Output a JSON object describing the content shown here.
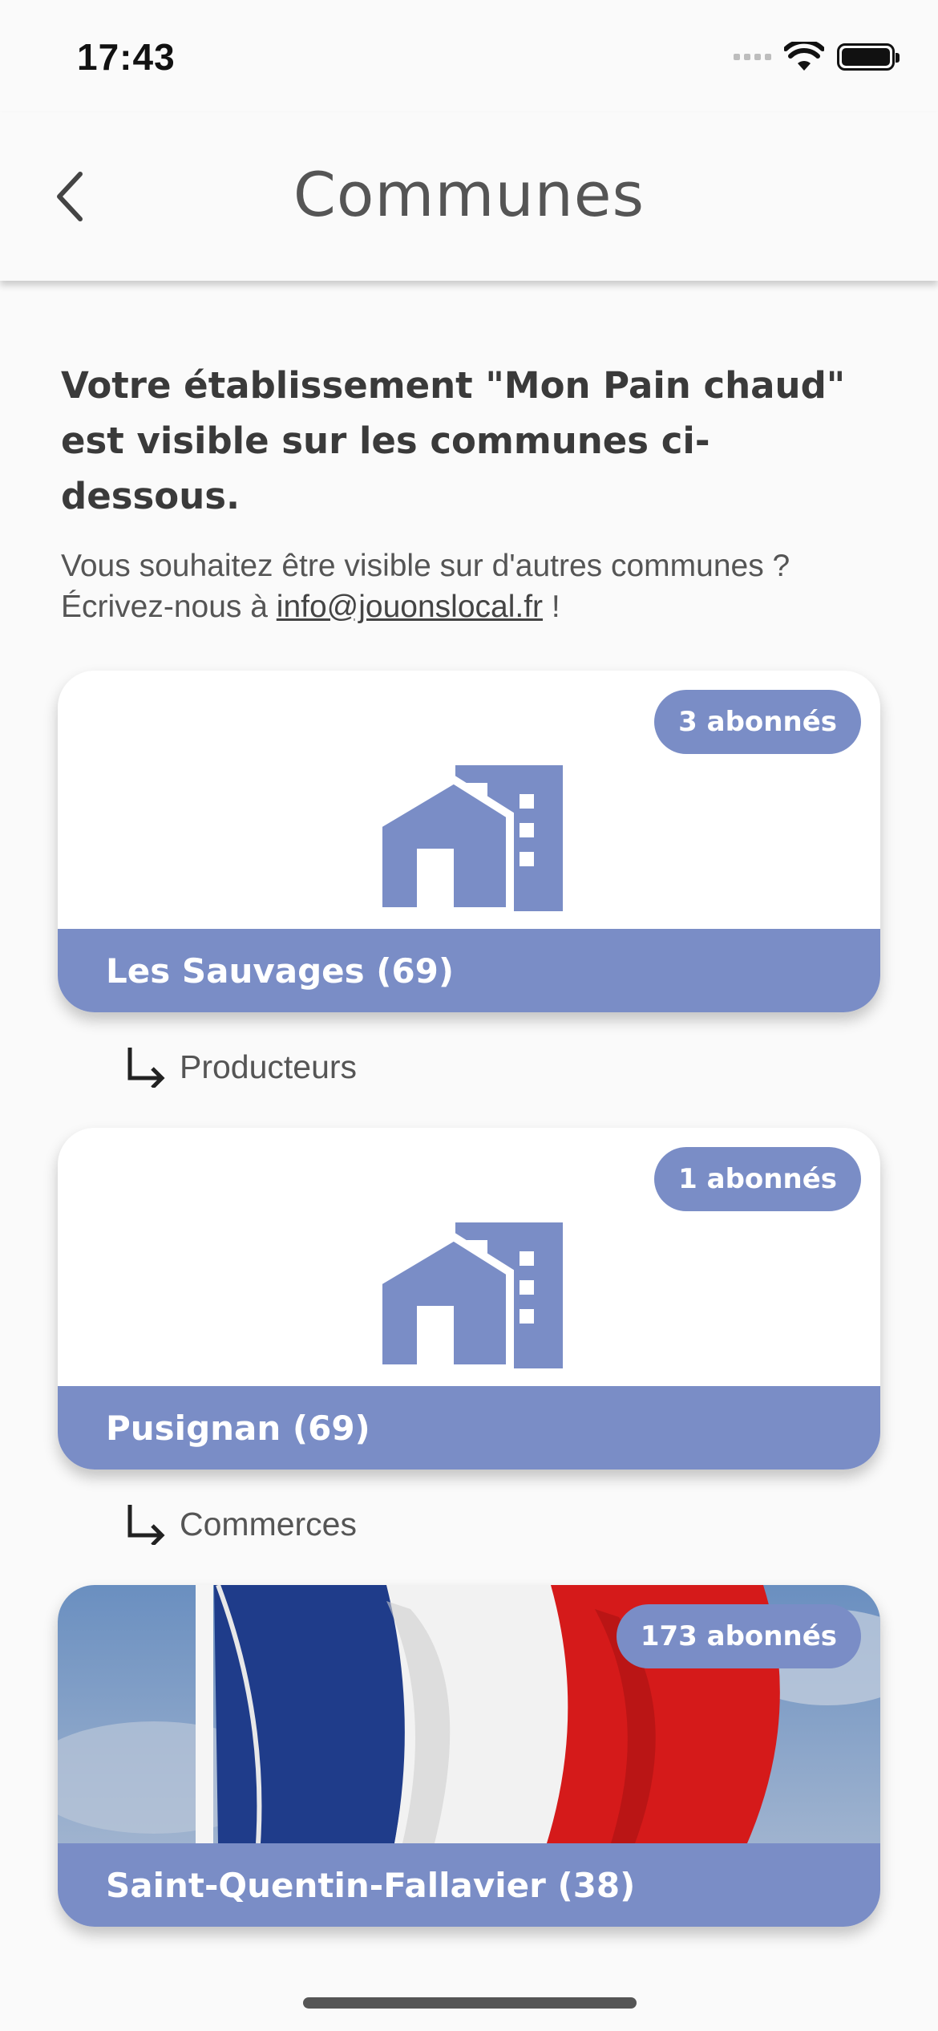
{
  "status": {
    "time": "17:43"
  },
  "nav": {
    "title": "Communes"
  },
  "intro": {
    "headline": "Votre établissement \"Mon Pain chaud\" est visible sur les communes ci-dessous.",
    "sub_text": "Vous souhaitez être visible sur d'autres communes ? Écrivez-nous à ",
    "email": "info@jouonslocal.fr",
    "sub_end": " !"
  },
  "communes": [
    {
      "name": "Les Sauvages (69)",
      "subscribers": "3 abonnés",
      "image": "building-icon",
      "category": "Producteurs"
    },
    {
      "name": "Pusignan (69)",
      "subscribers": "1 abonnés",
      "image": "building-icon",
      "category": "Commerces"
    },
    {
      "name": "Saint-Quentin-Fallavier (38)",
      "subscribers": "173 abonnés",
      "image": "french-flag-photo"
    }
  ],
  "colors": {
    "accent": "#7a8dc6",
    "background": "#fafafa"
  }
}
